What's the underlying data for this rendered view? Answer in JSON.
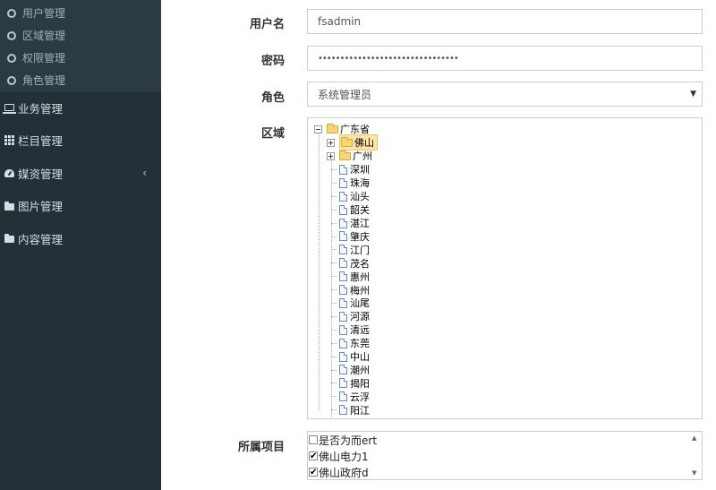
{
  "sidebar": {
    "sub_items": [
      {
        "label": "用户管理"
      },
      {
        "label": "区域管理"
      },
      {
        "label": "权限管理"
      },
      {
        "label": "角色管理"
      }
    ],
    "main_items": [
      {
        "label": "业务管理",
        "icon": "laptop-icon"
      },
      {
        "label": "栏目管理",
        "icon": "grid-icon"
      },
      {
        "label": "媒资管理",
        "icon": "dashboard-icon",
        "arrow": "‹"
      },
      {
        "label": "图片管理",
        "icon": "folder-icon"
      },
      {
        "label": "内容管理",
        "icon": "folder-icon"
      }
    ]
  },
  "form": {
    "username": {
      "label": "用户名",
      "value": "fsadmin"
    },
    "password": {
      "label": "密码",
      "value": "••••••••••••••••••••••••••••••••"
    },
    "role": {
      "label": "角色",
      "value": "系统管理员",
      "caret": "▼"
    },
    "region": {
      "label": "区域",
      "root": "广东省",
      "children": [
        "佛山",
        "广州"
      ],
      "leaves": [
        "深圳",
        "珠海",
        "汕头",
        "韶关",
        "湛江",
        "肇庆",
        "江门",
        "茂名",
        "惠州",
        "梅州",
        "汕尾",
        "河源",
        "清远",
        "东莞",
        "中山",
        "潮州",
        "揭阳",
        "云浮",
        "阳江"
      ]
    },
    "projects": {
      "label": "所属项目",
      "items": [
        {
          "label": "是否为而ert",
          "checked": false
        },
        {
          "label": "佛山电力1",
          "checked": true
        },
        {
          "label": "佛山政府d",
          "checked": true
        }
      ],
      "check_mark": "✔",
      "scroll_up": "▲",
      "scroll_down": "▼"
    }
  }
}
